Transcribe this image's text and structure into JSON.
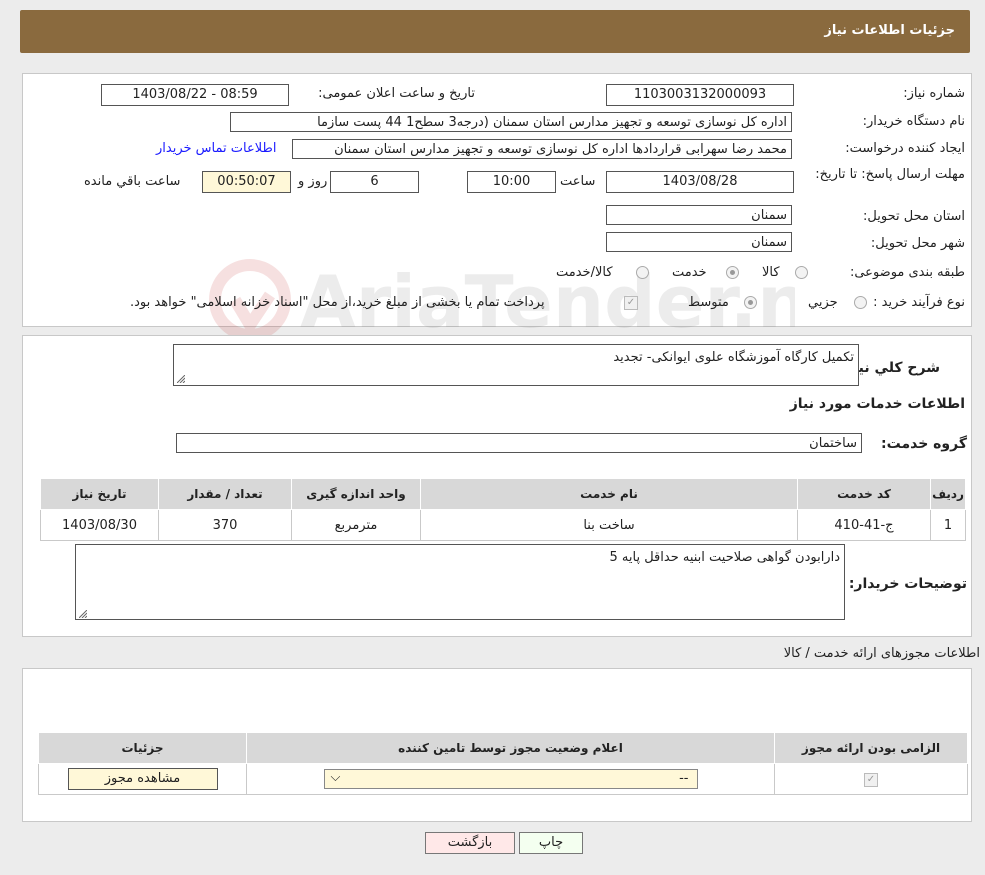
{
  "header": {
    "title": "جزئیات اطلاعات نیاز"
  },
  "watermark": {
    "text": "AriaTender.net"
  },
  "info": {
    "need_number_label": "شماره نیاز:",
    "need_number": "1103003132000093",
    "announce_label": "تاریخ و ساعت اعلان عمومی:",
    "announce_value": "1403/08/22 - 08:59",
    "buyer_label": "نام دستگاه خریدار:",
    "buyer_value": "اداره کل نوسازی   توسعه و تجهیز مدارس استان سمنان (درجه3  سطح1  44 پست سازما",
    "creator_label": "ایجاد کننده درخواست:",
    "creator_value": "محمد رضا سهرابی قراردادها اداره کل نوسازی   توسعه و تجهیز مدارس استان سمنان",
    "contact_link": "اطلاعات تماس خریدار",
    "deadline_label": "مهلت ارسال پاسخ: تا تاریخ:",
    "deadline_date": "1403/08/28",
    "time_label": "ساعت",
    "deadline_time": "10:00",
    "days_value": "6",
    "days_label": "روز و",
    "remaining_value": "00:50:07",
    "remaining_label": "ساعت باقي مانده",
    "province_label": "استان محل تحویل:",
    "province_value": "سمنان",
    "city_label": "شهر محل تحویل:",
    "city_value": "سمنان",
    "category_label": "طبقه بندی موضوعی:",
    "category_options": [
      "کالا",
      "خدمت",
      "کالا/خدمت"
    ],
    "process_label": "نوع فرآیند خرید :",
    "process_options": [
      "جزیي",
      "متوسط"
    ],
    "payment_note": "پرداخت تمام یا بخشی از مبلغ خرید،از محل \"اسناد خزانه اسلامی\" خواهد بود."
  },
  "desc": {
    "label": "شرح کلي نياز:",
    "value": "تکمیل کارگاه آموزشگاه علوی ایوانکی- تجدید",
    "services_title": "اطلاعات خدمات مورد نياز",
    "group_label": "گروه خدمت:",
    "group_value": "ساختمان"
  },
  "services_table": {
    "headers": [
      "رديف",
      "کد خدمت",
      "نام خدمت",
      "واحد اندازه گیری",
      "تعداد / مقدار",
      "تاریخ نیاز"
    ],
    "rows": [
      [
        "1",
        "ج-41-410",
        "ساخت بنا",
        "مترمربع",
        "370",
        "1403/08/30"
      ]
    ]
  },
  "buyer_notes": {
    "label": "توضیحات خریدار:",
    "value": "دارابودن گواهی صلاحیت ابنیه حداقل پایه 5"
  },
  "permits": {
    "title": "اطلاعات مجوزهای ارائه خدمت / کالا",
    "headers": [
      "الزامی بودن ارائه مجوز",
      "اعلام وضعیت مجوز توسط تامین کننده",
      "جزئیات"
    ],
    "select_value": "--",
    "view_button": "مشاهده مجوز"
  },
  "actions": {
    "print": "چاپ",
    "back": "بازگشت"
  }
}
